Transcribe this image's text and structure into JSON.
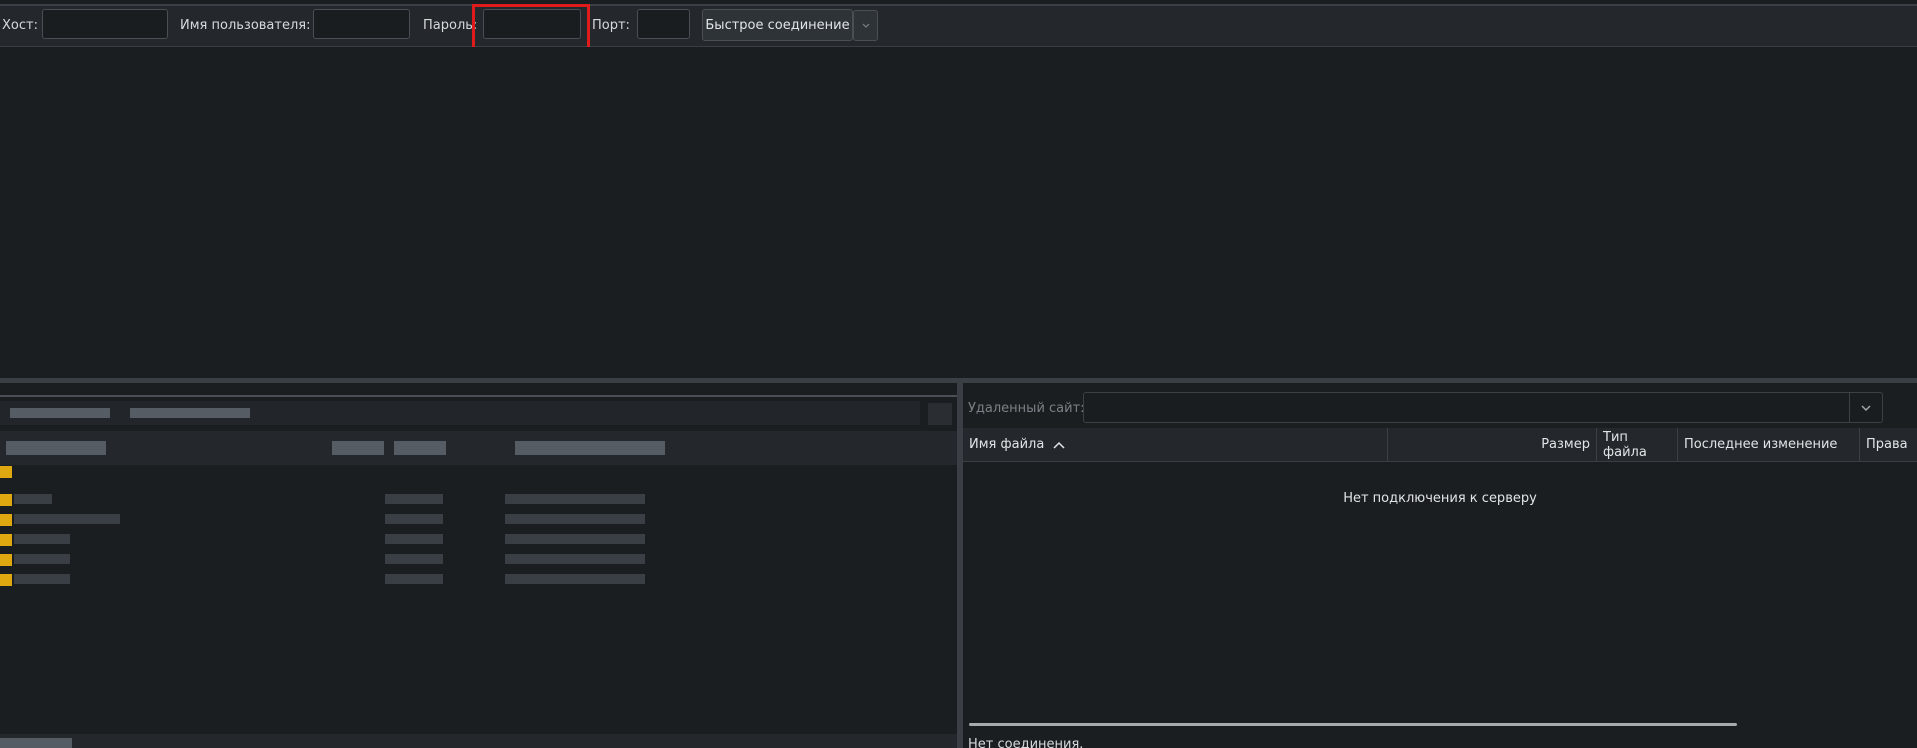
{
  "quickconnect": {
    "host_label": "Хост:",
    "host_value": "",
    "username_label": "Имя пользователя:",
    "username_value": "",
    "password_label": "Пароль:",
    "password_value": "",
    "port_label": "Порт:",
    "port_value": "",
    "connect_button": "Быстрое соединение",
    "dropdown_icon": "chevron-down-icon"
  },
  "highlight": {
    "color": "#e01b1b",
    "target": "password-input"
  },
  "remote": {
    "site_label": "Удаленный сайт:",
    "site_value": "",
    "columns": [
      "Имя файла",
      "Размер",
      "Тип файла",
      "Последнее изменение",
      "Права"
    ],
    "sort_icon": "chevron-up-icon",
    "empty_message": "Нет подключения к серверу",
    "status": "Нет соединения."
  },
  "colors": {
    "background": "#1b1e21",
    "toolbar": "#24282c",
    "folder": "#e0a810"
  }
}
